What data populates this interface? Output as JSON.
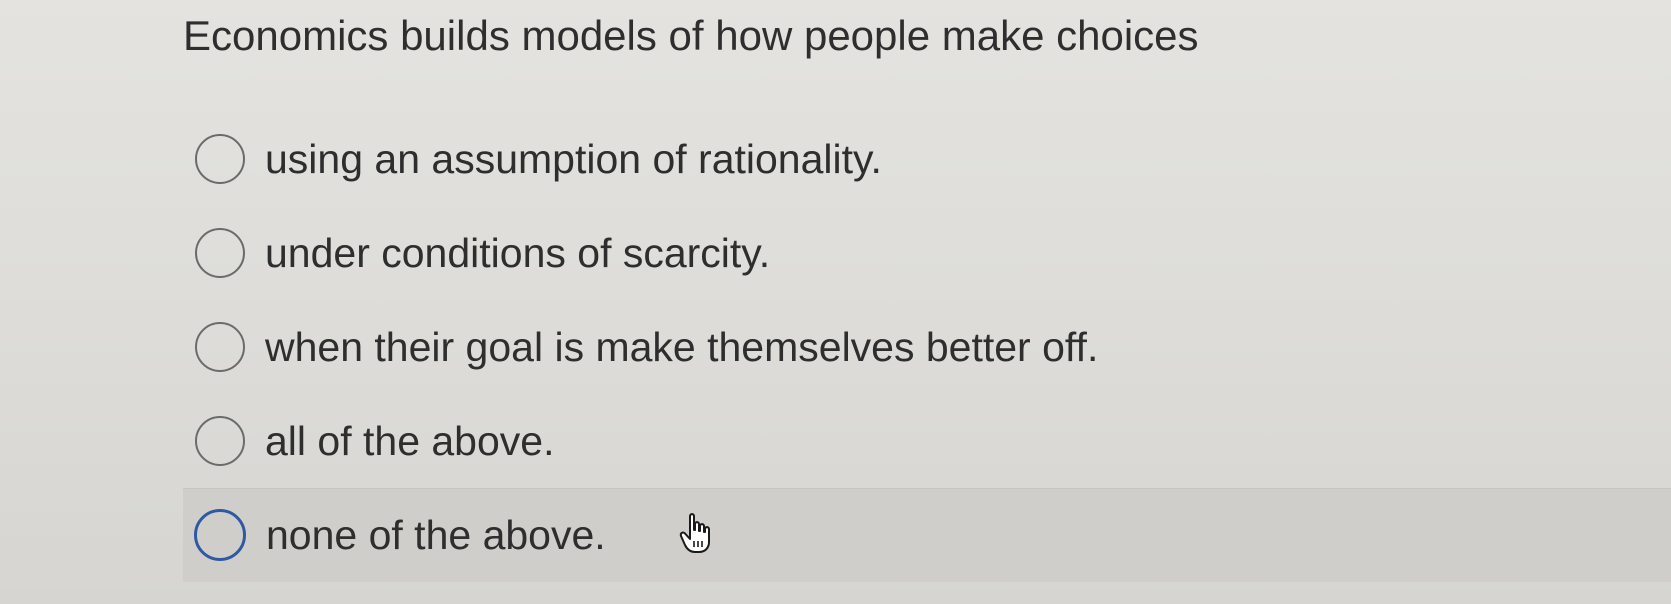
{
  "question": {
    "text": "Economics builds models of how people make choices"
  },
  "options": [
    {
      "label": "using an assumption of rationality."
    },
    {
      "label": "under conditions of scarcity."
    },
    {
      "label": "when their goal is make themselves better off."
    },
    {
      "label": "all of the above."
    },
    {
      "label": "none of the above."
    }
  ],
  "colors": {
    "background": "#dddcd8",
    "text": "#2e2e2e",
    "radio_border": "#6b6b6b",
    "hover_radio_border": "#2f5aa3",
    "hover_row": "#cfceca"
  },
  "icons": {
    "cursor": "hand-pointer-icon"
  }
}
